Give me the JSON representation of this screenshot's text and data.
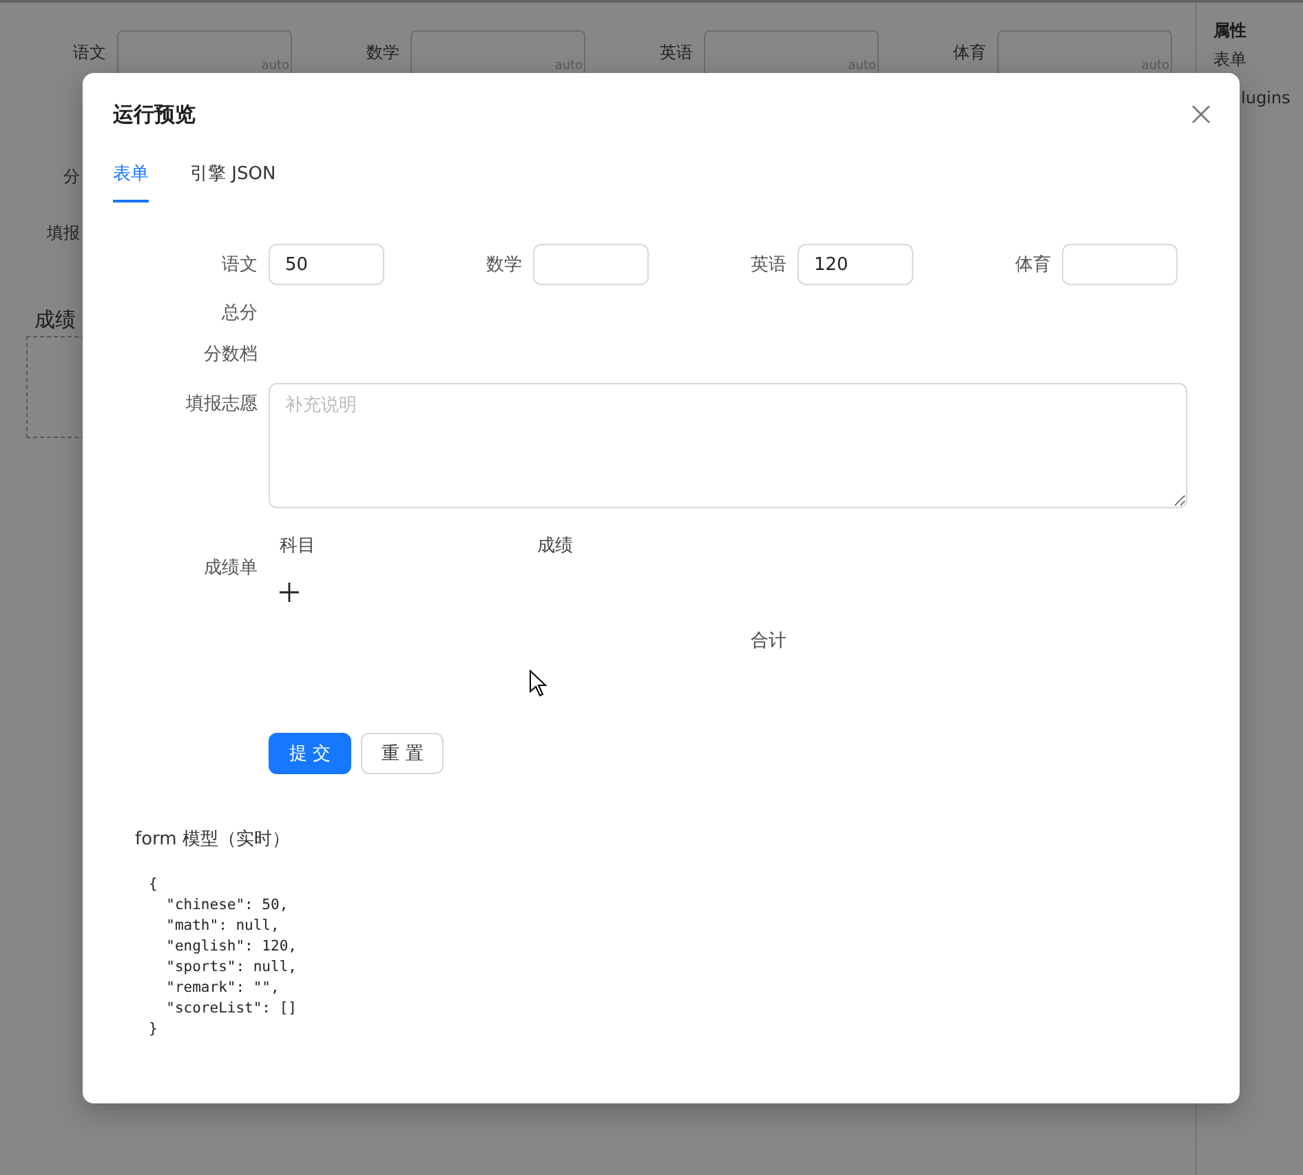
{
  "background": {
    "fields": [
      {
        "label": "语文",
        "suffix": "auto"
      },
      {
        "label": "数学",
        "suffix": "auto"
      },
      {
        "label": "英语",
        "suffix": "auto"
      },
      {
        "label": "体育",
        "suffix": "auto"
      }
    ],
    "side_labels": [
      "分",
      "填报"
    ],
    "section_title": "成绩",
    "panel": {
      "title": "属性",
      "items": [
        "表单",
        "lugins"
      ]
    }
  },
  "dialog": {
    "title": "运行预览",
    "tabs": [
      {
        "label": "表单",
        "selected": true
      },
      {
        "label": "引擎 JSON",
        "selected": false
      }
    ],
    "form": {
      "score_fields": [
        {
          "label": "语文",
          "value": "50"
        },
        {
          "label": "数学"
        },
        {
          "label": "英语",
          "value": "120"
        },
        {
          "label": "体育"
        }
      ],
      "computed": [
        {
          "label": "总分"
        },
        {
          "label": "分数档"
        }
      ],
      "remark": {
        "label": "填报志愿",
        "placeholder": "补充说明"
      },
      "score_list": {
        "label": "成绩单",
        "columns": [
          "科目",
          "成绩"
        ],
        "total_label": "合计"
      },
      "buttons": [
        {
          "label": "提 交",
          "kind": "primary"
        },
        {
          "label": "重 置",
          "kind": "default"
        }
      ]
    },
    "model": {
      "title": "form 模型（实时）",
      "code_lines": [
        "{",
        "  \"chinese\": 50,",
        "  \"math\": null,",
        "  \"english\": 120,",
        "  \"sports\": null,",
        "  \"remark\": \"\",",
        "  \"scoreList\": []",
        "}"
      ]
    }
  }
}
